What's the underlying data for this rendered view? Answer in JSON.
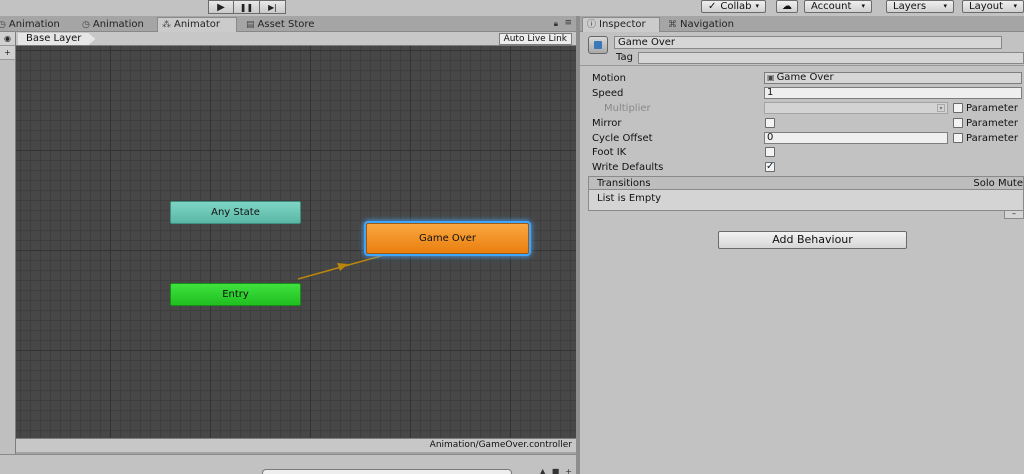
{
  "toolbar": {
    "play_icon": "▶",
    "pause_icon": "❚❚",
    "step_icon": "▶|",
    "collab_label": "Collab",
    "account_label": "Account",
    "layers_label": "Layers",
    "layout_label": "Layout",
    "cloud_icon": "☁",
    "caret": "▾"
  },
  "left_tabs": [
    {
      "icon": "◷",
      "label": "Animation"
    },
    {
      "icon": "◷",
      "label": "Animation"
    },
    {
      "icon": "⁂",
      "label": "Animator"
    },
    {
      "icon": "▤",
      "label": "Asset Store"
    }
  ],
  "animator": {
    "breadcrumb": "Base Layer",
    "auto_live_link": "Auto Live Link",
    "strip_icons": [
      "◉",
      "+"
    ],
    "nodes": {
      "any_state": "Any State",
      "entry": "Entry",
      "game_over": "Game Over"
    },
    "controller_path": "Animation/GameOver.controller",
    "colors": {
      "any_state": "#6cc9b9",
      "entry": "#2fd22f",
      "game_over": "#f4921f",
      "transition": "#b8860b",
      "selection": "#3ea6ff"
    }
  },
  "right_tabs": [
    {
      "icon": "ⓘ",
      "label": "Inspector"
    },
    {
      "icon": "⌘",
      "label": "Navigation"
    }
  ],
  "inspector": {
    "state_name": "Game Over",
    "tag_label": "Tag",
    "tag_value": "",
    "props": {
      "motion_label": "Motion",
      "motion_value": "Game Over",
      "speed_label": "Speed",
      "speed_value": "1",
      "multiplier_label": "Multiplier",
      "mirror_label": "Mirror",
      "cycle_offset_label": "Cycle Offset",
      "cycle_offset_value": "0",
      "foot_ik_label": "Foot IK",
      "write_defaults_label": "Write Defaults",
      "parameter_label": "Parameter",
      "check_mark": "✓"
    },
    "transitions": {
      "title": "Transitions",
      "solo_mute": "Solo Mute",
      "empty": "List is Empty",
      "minus": "–"
    },
    "add_behaviour": "Add Behaviour"
  }
}
